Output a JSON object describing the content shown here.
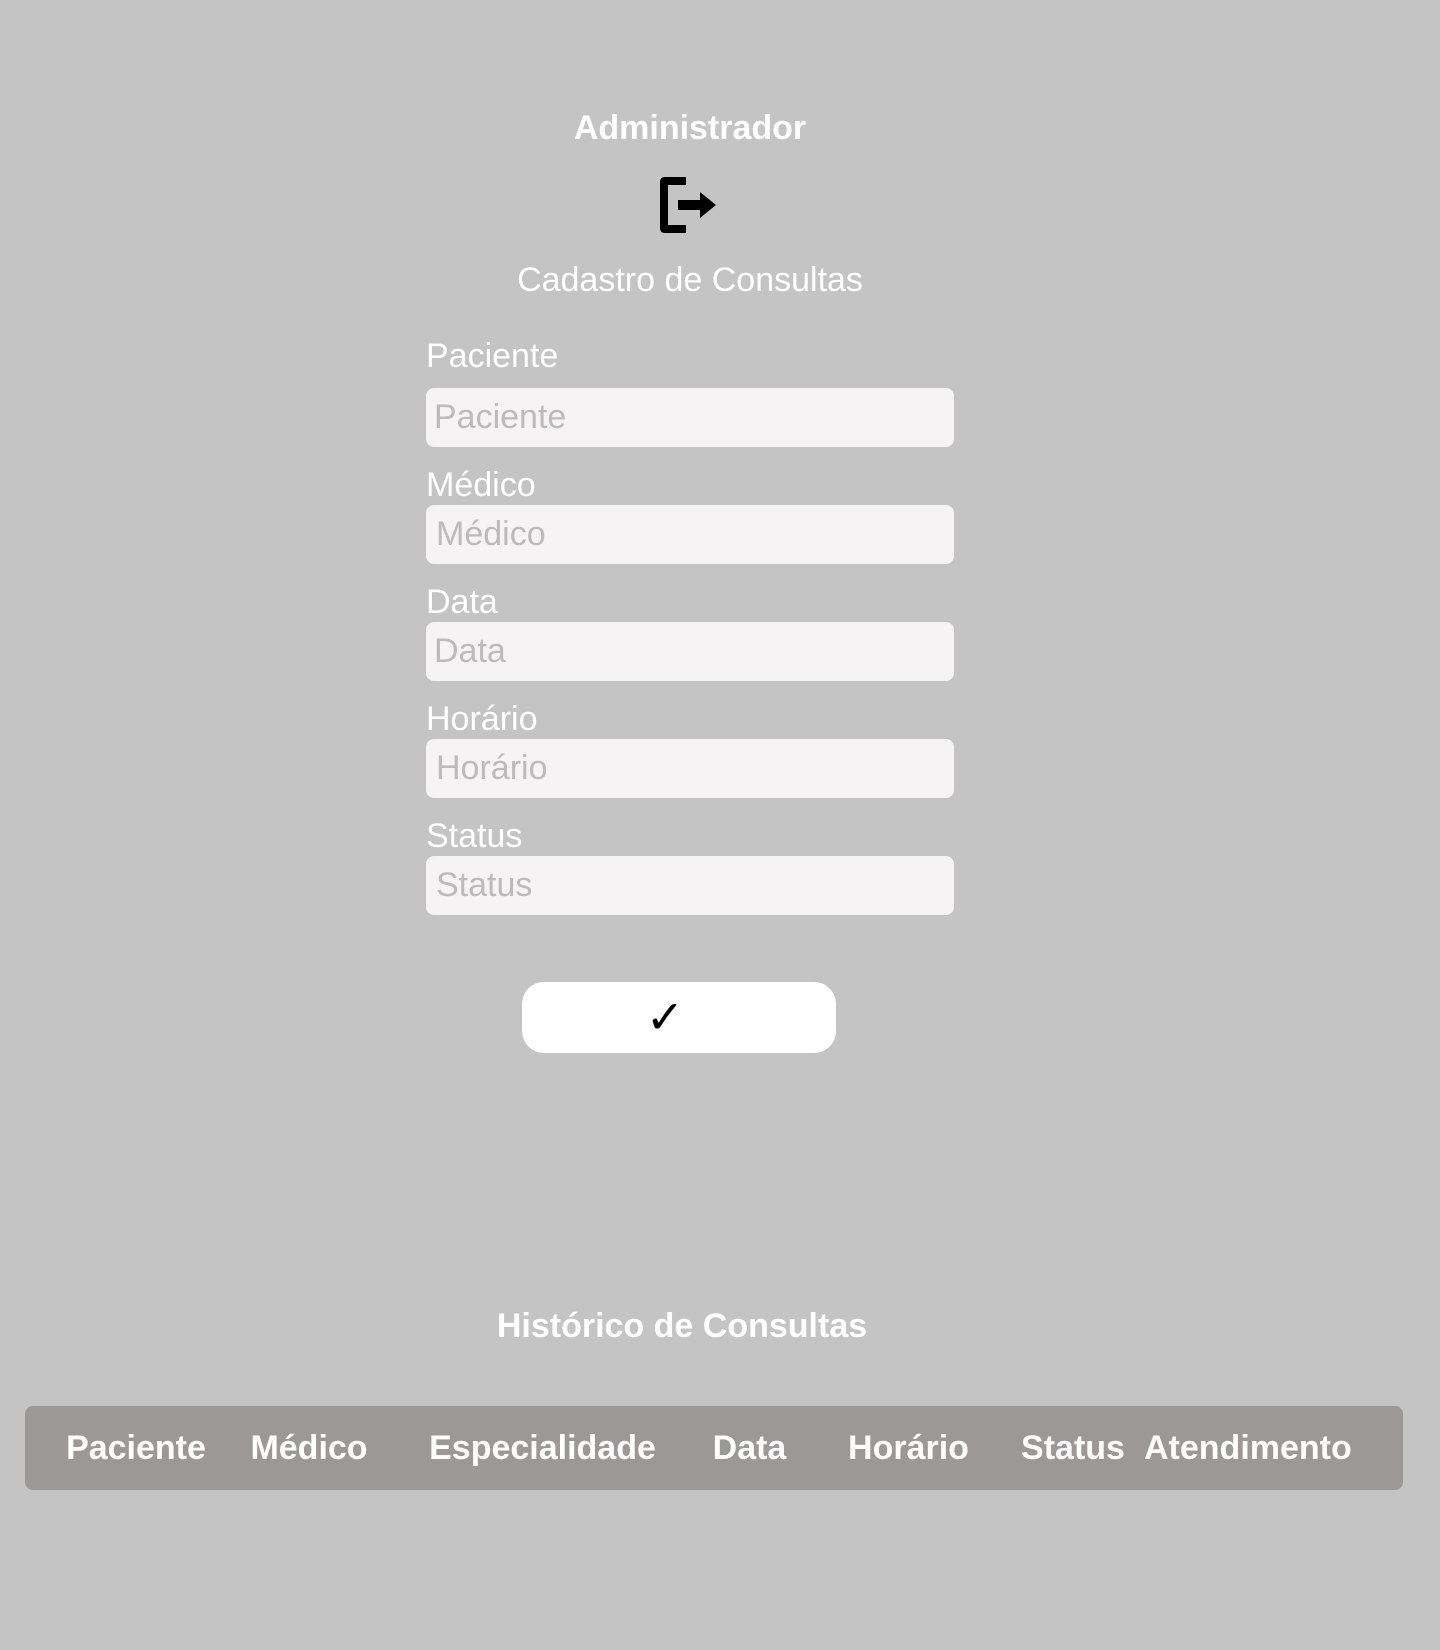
{
  "header": {
    "user_title": "Administrador",
    "logout_icon": "logout-icon"
  },
  "form": {
    "title": "Cadastro de Consultas",
    "fields": [
      {
        "label": "Paciente",
        "placeholder": "Paciente"
      },
      {
        "label": "Médico",
        "placeholder": "Médico"
      },
      {
        "label": "Data",
        "placeholder": "Data"
      },
      {
        "label": "Horário",
        "placeholder": "Horário"
      },
      {
        "label": "Status",
        "placeholder": "Status"
      }
    ],
    "submit_label": "✓"
  },
  "history": {
    "title": "Histórico de Consultas",
    "columns": [
      "Paciente",
      "Médico",
      "Especialidade",
      "Data",
      "Horário",
      "Status",
      "Atendimento"
    ]
  },
  "colors": {
    "background": "#c4c4c4",
    "input_background": "#f5f3f4",
    "table_header_background": "#9c9898",
    "text_light": "#ffffff"
  }
}
